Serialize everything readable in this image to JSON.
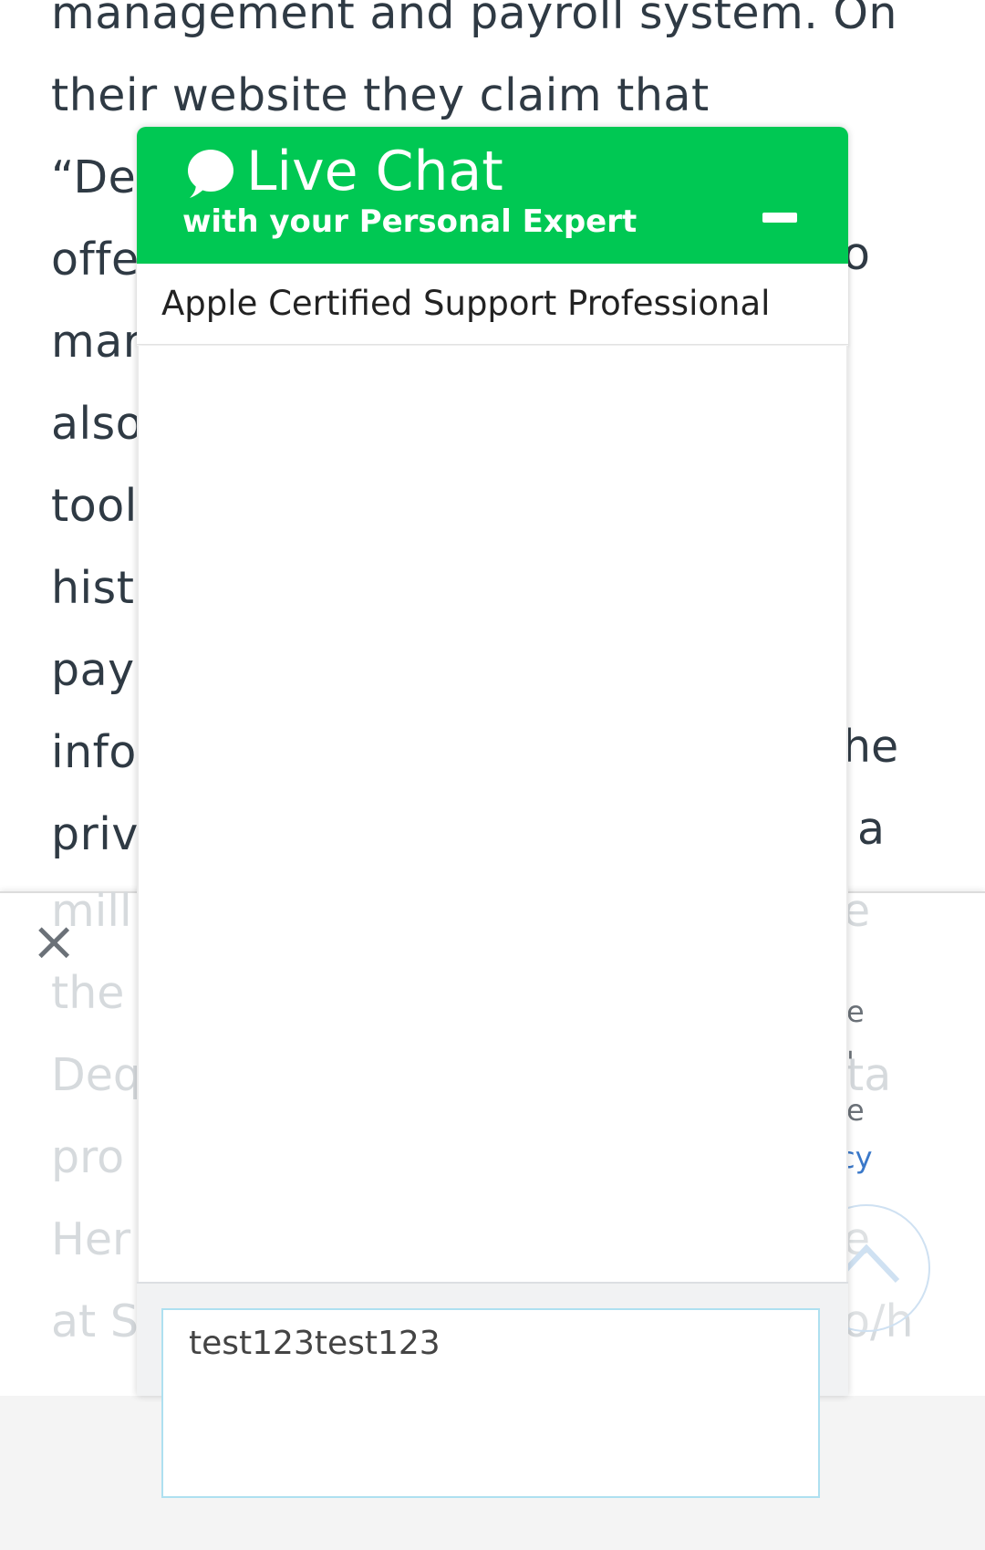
{
  "article": {
    "lines": [
      "management and payroll system. On",
      "their website they claim that",
      "“De",
      "offe",
      "mar",
      "also",
      "tool",
      "hist",
      "pay",
      "info",
      "priv"
    ],
    "right_fragments": [
      "o",
      "he",
      "a"
    ]
  },
  "banner": {
    "close_glyph": "×",
    "faded_lines": [
      "mill",
      "the",
      "Deq",
      "pro",
      "Her",
      "at S"
    ],
    "faded_right": [
      "e",
      "ta",
      "e",
      "o/h"
    ],
    "small_fragments": [
      "e",
      "'",
      "e",
      "cy"
    ]
  },
  "chat": {
    "title": "Live Chat",
    "subtitle": "with your Personal Expert",
    "agent_label": "Apple Certified Support Professional",
    "input_value": "test123test123",
    "colors": {
      "header": "#00c853",
      "input_border": "#aee0f0"
    },
    "icons": {
      "chat_bubble": "chat-bubble-icon",
      "minimize": "minimize-icon",
      "close": "close-icon",
      "scroll_top": "chevron-up-icon"
    }
  }
}
